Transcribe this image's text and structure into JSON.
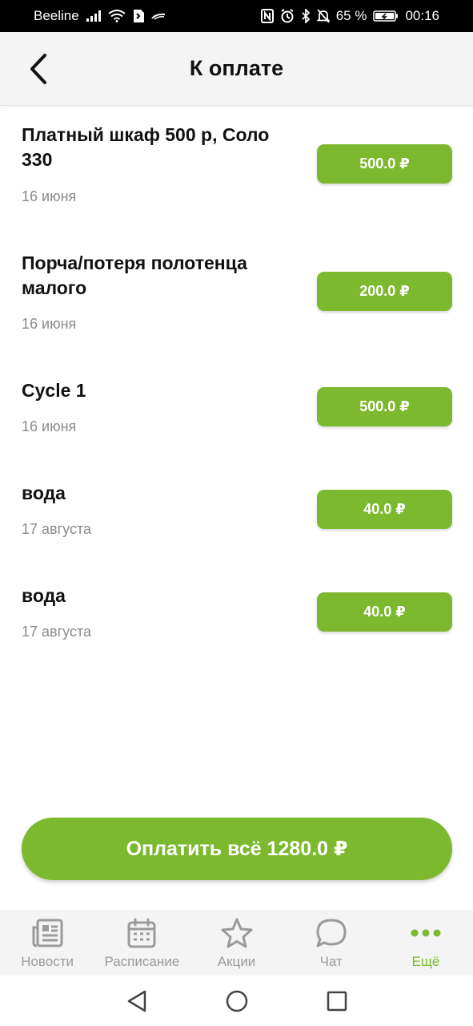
{
  "status_bar": {
    "carrier": "Beeline",
    "battery": "65 %",
    "time": "00:16",
    "icons": [
      "signal-icon",
      "wifi-icon",
      "sim-icon",
      "nfc-icon",
      "alarm-icon",
      "bluetooth-icon",
      "mute-icon",
      "battery-icon"
    ]
  },
  "header": {
    "title": "К оплате",
    "back_icon": "chevron-left-icon"
  },
  "payments": [
    {
      "title": "Платный шкаф 500 р, Соло 330",
      "date": "16 июня",
      "amount": "500.0 ₽"
    },
    {
      "title": "Порча/потеря полотенца малого",
      "date": "16 июня",
      "amount": "200.0 ₽"
    },
    {
      "title": "Cycle 1",
      "date": "16 июня",
      "amount": "500.0 ₽"
    },
    {
      "title": "вода",
      "date": "17 августа",
      "amount": "40.0 ₽"
    },
    {
      "title": "вода",
      "date": "17 августа",
      "amount": "40.0 ₽"
    }
  ],
  "pay_all_label": "Оплатить всё 1280.0 ₽",
  "tabs": [
    {
      "label": "Новости",
      "icon": "news-icon",
      "active": false
    },
    {
      "label": "Расписание",
      "icon": "calendar-icon",
      "active": false
    },
    {
      "label": "Акции",
      "icon": "star-icon",
      "active": false
    },
    {
      "label": "Чат",
      "icon": "chat-icon",
      "active": false
    },
    {
      "label": "Ещё",
      "icon": "more-icon",
      "active": true
    }
  ],
  "colors": {
    "accent": "#7db92e",
    "inactive": "#9a9a9a",
    "header_bg": "#f4f4f4"
  }
}
